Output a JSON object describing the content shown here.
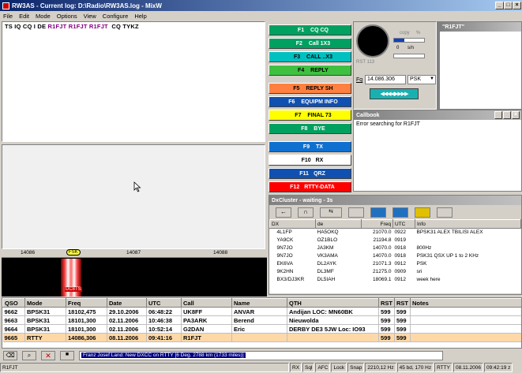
{
  "window": {
    "title": "RW3AS - Current log: D:\\Radio\\RW3AS.log - MixW"
  },
  "menu": [
    "File",
    "Edit",
    "Mode",
    "Options",
    "View",
    "Configure",
    "Help"
  ],
  "rx": {
    "segments": [
      {
        "text": "TS IQ CQ I DE ",
        "color": "#000000"
      },
      {
        "text": "R1FJT",
        "color": "#800080"
      },
      {
        "text": " ",
        "color": "#000000"
      },
      {
        "text": "R1FJT",
        "color": "#800080"
      },
      {
        "text": " ",
        "color": "#000000"
      },
      {
        "text": "R1FJT",
        "color": "#800080"
      },
      {
        "text": "  CQ TYKZ",
        "color": "#000000"
      }
    ]
  },
  "macros": [
    {
      "key": "F1",
      "label": "CQ CQ",
      "bg": "#00a060",
      "fg": "#ffffff"
    },
    {
      "key": "F2",
      "label": "Call 1X3",
      "bg": "#00a060",
      "fg": "#ffffff"
    },
    {
      "key": "F3",
      "label": "CALL ..X3",
      "bg": "#00c0c0",
      "fg": "#000000"
    },
    {
      "key": "F4",
      "label": "REPLY",
      "bg": "#40c040",
      "fg": "#000000"
    },
    {
      "key": "F5",
      "label": "REPLY SH",
      "bg": "#ff8040",
      "fg": "#000000"
    },
    {
      "key": "F6",
      "label": "EQUIPM INFO",
      "bg": "#1050b0",
      "fg": "#ffffff"
    },
    {
      "key": "F7",
      "label": "FINAL 73",
      "bg": "#ffff00",
      "fg": "#000000"
    },
    {
      "key": "F8",
      "label": "BYE",
      "bg": "#00a060",
      "fg": "#ffffff"
    },
    {
      "key": "F9",
      "label": "TX",
      "bg": "#1070d0",
      "fg": "#ffffff"
    },
    {
      "key": "F10",
      "label": "RX",
      "bg": "#ffffff",
      "fg": "#000000"
    },
    {
      "key": "F11",
      "label": "QRZ",
      "bg": "#1050b0",
      "fg": "#ffffff"
    },
    {
      "key": "F12",
      "label": "RTTY-DATA",
      "bg": "#ff0000",
      "fg": "#ffffff"
    }
  ],
  "meter": {
    "copy_label": "copy",
    "s_label": "s/n",
    "rst_label": "RST 113",
    "zero": "0",
    "percent": "%"
  },
  "freq": {
    "label": "Fq",
    "value": "14.086.306",
    "mode": "PSK"
  },
  "callsign_panel": {
    "title": "\"R1FJT\""
  },
  "callbook": {
    "title": "Callbook",
    "text": "Error searching for R1FJT"
  },
  "dxcluster": {
    "title": "DxCluster - waiting - 3s",
    "columns": [
      "DX",
      "de",
      "Freq",
      "UTC",
      "Info"
    ],
    "rows": [
      {
        "dx": "4L1FP",
        "de": "HA5OKQ",
        "freq": "21070.0",
        "utc": "0922",
        "info": "BPSK31 ALEX TBILISI ALEX"
      },
      {
        "dx": "YA9CK",
        "de": "OZ1BLO",
        "freq": "21194.8",
        "utc": "0919",
        "info": ""
      },
      {
        "dx": "9N7JO",
        "de": "JA3KM",
        "freq": "14070.0",
        "utc": "0918",
        "info": "800Hz"
      },
      {
        "dx": "9N7JO",
        "de": "VK3AMA",
        "freq": "14070.0",
        "utc": "0918",
        "info": "PSK31 QSX UP 1 to 2 KHz"
      },
      {
        "dx": "EK6VA",
        "de": "DL2AYK",
        "freq": "21071.3",
        "utc": "0912",
        "info": "PSK"
      },
      {
        "dx": "9K2HN",
        "de": "DL3MF",
        "freq": "21275.0",
        "utc": "0909",
        "info": "sri"
      },
      {
        "dx": "BX3/DJ3KR",
        "de": "DL5IAH",
        "freq": "18069.1",
        "utc": "0912",
        "info": "week here"
      }
    ]
  },
  "waterfall": {
    "scale": [
      "14086",
      "14087",
      "14088"
    ],
    "marker": "FSK",
    "label": "DC8TS"
  },
  "log": {
    "columns": [
      "QSO",
      "Mode",
      "Freq",
      "Date",
      "UTC",
      "Call",
      "Name",
      "QTH",
      "RST",
      "RST",
      "Notes"
    ],
    "rows": [
      {
        "qso": "9662",
        "mode": "BPSK31",
        "freq": "18102,475",
        "date": "29.10.2006",
        "utc": "06:48:22",
        "call": "UK8FF",
        "name": "ANVAR",
        "qth": "Andijan LOC: MN60BK",
        "rst1": "599",
        "rst2": "599",
        "notes": ""
      },
      {
        "qso": "9663",
        "mode": "BPSK31",
        "freq": "18101,300",
        "date": "02.11.2006",
        "utc": "10:46:38",
        "call": "PA3ARK",
        "name": "Berend",
        "qth": "Nieuwolda",
        "rst1": "599",
        "rst2": "599",
        "notes": ""
      },
      {
        "qso": "9664",
        "mode": "BPSK31",
        "freq": "18101,300",
        "date": "02.11.2006",
        "utc": "10:52:14",
        "call": "G2DAN",
        "name": "Eric",
        "qth": "DERBY DE3 5JW  Loc: IO93",
        "rst1": "599",
        "rst2": "599",
        "notes": ""
      },
      {
        "qso": "9665",
        "mode": "RTTY",
        "freq": "14086,306",
        "date": "08.11.2006",
        "utc": "09:41:16",
        "call": "R1FJT",
        "name": "",
        "qth": "",
        "rst1": "599",
        "rst2": "599",
        "notes": ""
      }
    ]
  },
  "info_bar": {
    "text": "Franz Josef Land:  New DXCC on RTTY [6 Deg. 2788 km (1733 miles)]"
  },
  "status": {
    "call": "R1FJT",
    "items": [
      "RX",
      "Sql",
      "AFC",
      "Lock",
      "Snap",
      "2210,12 Hz",
      "45 bd, 170 Hz",
      "RTTY",
      "08.11.2006",
      "09:42:19 z"
    ]
  },
  "colors": {
    "titlebar": "#0a246a",
    "selected_row": "#ffd8a8",
    "waterfall": "#000000"
  }
}
